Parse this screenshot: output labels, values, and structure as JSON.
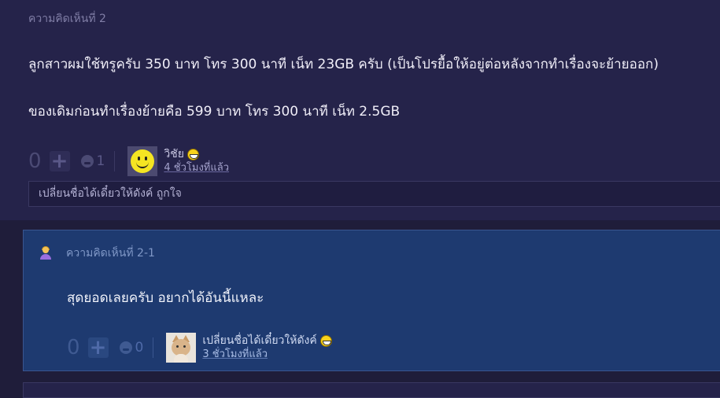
{
  "comment": {
    "header": "ความคิดเห็นที่ 2",
    "paragraphs": [
      "ลูกสาวผมใช้ทรูครับ 350 บาท โทร 300 นาที เน็ท 23GB ครับ (เป็นโปรยื้อให้อยู่ต่อหลังจากทำเรื่องจะย้ายออก)",
      "ของเดิมก่อนทำเรื่องย้ายคือ 599 บาท โทร 300 นาที เน็ท 2.5GB"
    ],
    "votes": "0",
    "emotion_count": "1",
    "author": "วิชัย",
    "time": "4 ชั่วโมงที่แล้ว",
    "edit_placeholder": "เปลี่ยนชื่อได้เดี๋ยวให้ดังค์ ถูกใจ"
  },
  "reply": {
    "header": "ความคิดเห็นที่ 2-1",
    "body": "สุดยอดเลยครับ อยากได้อันนี้แหละ",
    "votes": "0",
    "emotion_count": "0",
    "author": "เปลี่ยนชื่อได้เดี๋ยวให้ดังค์",
    "time": "3 ชั่วโมงที่แล้ว"
  },
  "icons": {
    "plus": "plus-icon",
    "emotion": "emotion-icon",
    "laugh": "laugh-emoji-icon",
    "person": "person-icon"
  },
  "colors": {
    "background": "#1f1d3a",
    "comment_bg": "#25234a",
    "reply_bg": "#1e3a70"
  }
}
